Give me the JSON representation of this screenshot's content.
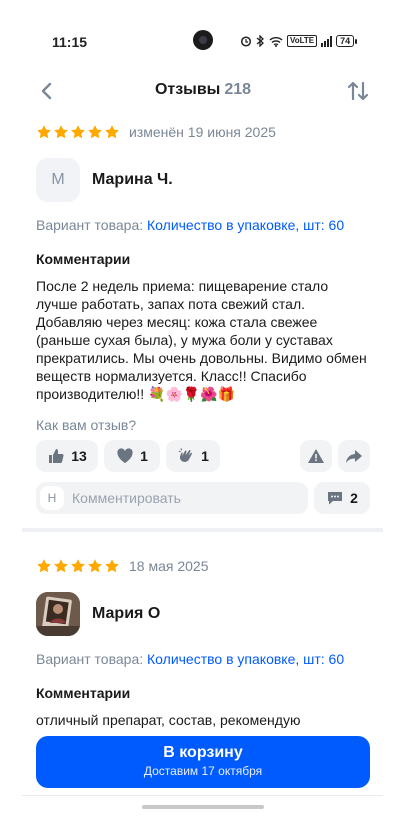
{
  "status_bar": {
    "time": "11:15",
    "battery": "74",
    "volte": "VoLTE"
  },
  "header": {
    "title": "Отзывы",
    "count": "218"
  },
  "reviews": [
    {
      "rating": 5,
      "date": "изменён 19 июня 2025",
      "avatar_letter": "М",
      "author": "Марина Ч.",
      "variant_label": "Вариант товара: ",
      "variant_value": "Количество в упаковке, шт: 60",
      "comment_label": "Комментарии",
      "comment_text": "После 2 недель приема: пищеварение стало лучше работать, запах пота свежий стал. Добавляю через месяц: кожа стала свежее (раньше сухая была), у мужа боли у суставах прекратились. Мы очень довольны. Видимо обмен веществ нормализуется. Класс!! Спасибо производителю!! 💐🌸🌹🌺🎁",
      "feedback_question": "Как вам отзыв?",
      "likes": "13",
      "hearts": "1",
      "claps": "1",
      "comment_input_badge": "Н",
      "comment_placeholder": "Комментировать",
      "comments_count": "2"
    },
    {
      "rating": 5,
      "date": "18 мая 2025",
      "author": "Мария О",
      "variant_label": "Вариант товара: ",
      "variant_value": "Количество в упаковке, шт: 60",
      "comment_label": "Комментарии",
      "comment_text": "отличный препарат, состав, рекомендую"
    }
  ],
  "cta": {
    "label": "В корзину",
    "sublabel": "Доставим 17 октября"
  },
  "colors": {
    "accent": "#005bff",
    "star": "#ffa800",
    "muted": "#7b8797"
  },
  "icons": [
    "back-arrow-icon",
    "sort-icon",
    "star-icon",
    "thumbs-up-icon",
    "heart-icon",
    "clap-icon",
    "warning-icon",
    "share-icon",
    "chat-icon"
  ]
}
